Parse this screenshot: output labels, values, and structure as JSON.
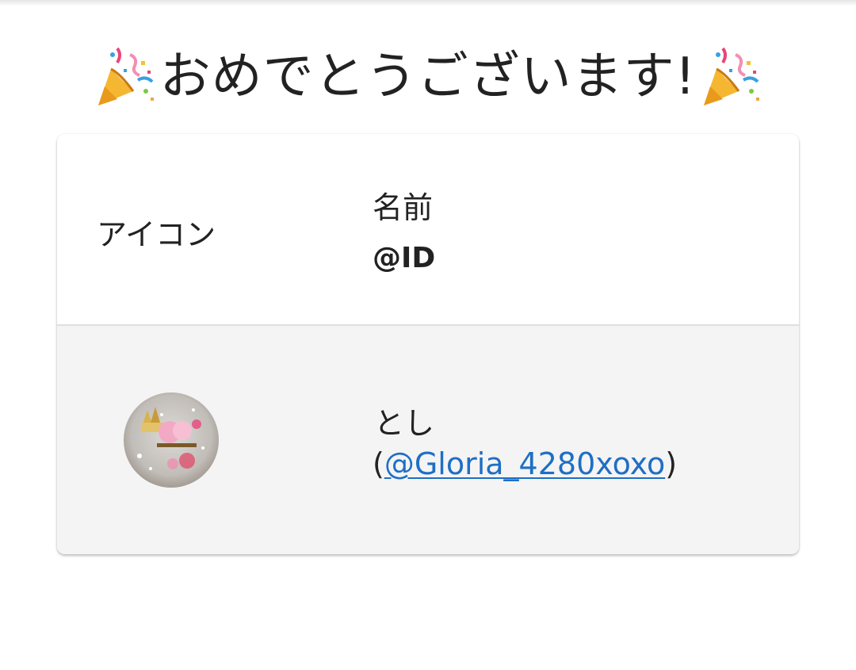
{
  "header": {
    "title": "おめでとうございます!",
    "title_icon": "party-popper-icon"
  },
  "table": {
    "columns": {
      "icon_label": "アイコン",
      "name_label": "名前",
      "id_label": "@ID"
    },
    "rows": [
      {
        "avatar": "avatar-image",
        "name": "とし",
        "id_open": "(",
        "id": "@Gloria_4280xoxo",
        "id_close": ")"
      }
    ]
  },
  "colors": {
    "link": "#1e6fc5",
    "row_background": "#f4f4f4",
    "text": "#222222"
  }
}
